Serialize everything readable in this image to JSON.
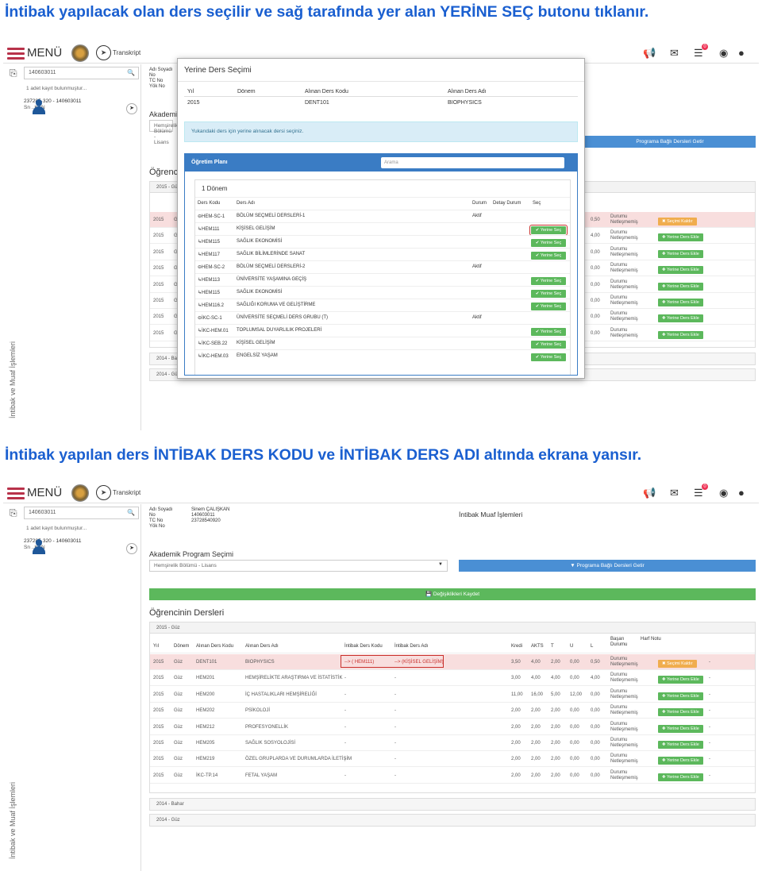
{
  "headings": {
    "top": "İntibak yapılacak olan ders seçilir ve sağ tarafında yer alan YERİNE SEÇ butonu tıklanır.",
    "bottom": "İntibak yapılan ders İNTİBAK DERS KODU ve İNTİBAK DERS ADI altında ekrana yansır."
  },
  "topbar": {
    "menu": "MENÜ",
    "transkript": "Transkript"
  },
  "sidebar": {
    "search_value": "140603011",
    "note": "1 adet kayıt bulunmuştur...",
    "student_line": "237285·320 - 140603011",
    "student_name_partial": "Sn ..KAN",
    "vertical_label": "İntibak ve Muaf İşlemleri"
  },
  "info": {
    "labels": [
      "Adı Soyadı",
      "No",
      "TC No",
      "Yök No"
    ],
    "values": [
      "Sinem ÇALIŞKAN",
      "140603011",
      "23728540920",
      ""
    ]
  },
  "page_title": "İntibak Muaf İşlemleri",
  "program": {
    "title": "Akademik Program Seçimi",
    "selected": "Hemşirelik Bölümü - Lisans",
    "btn": "Programa Bağlı Dersleri Getir"
  },
  "save_bar": "Değişiklikleri Kaydet",
  "courses": {
    "title": "Öğrencinin Dersleri",
    "term": "2015 - Güz",
    "headers": [
      "Yıl",
      "Dönem",
      "Alınan Ders Kodu",
      "Alınan Ders Adı",
      "İntibak Ders Kodu",
      "İntibak Ders Adı",
      "Kredi",
      "AKTS",
      "T",
      "U",
      "L",
      "Başarı Durumu",
      "Harf Notu"
    ],
    "rows": [
      [
        "2015",
        "Güz",
        "DENT101",
        "BIOPHYSICS",
        "--> ( HEM111)",
        "--> (KİŞİSEL GELİŞİM)",
        "3,50",
        "4,00",
        "2,00",
        "0,00",
        "0,50",
        "Durumu Netleşmemiş",
        "",
        ""
      ],
      [
        "2015",
        "Güz",
        "HEM201",
        "HEMŞİRELİKTE ARAŞTIRMA VE İSTATİSTİK",
        "-",
        "-",
        "3,00",
        "4,00",
        "4,00",
        "0,00",
        "4,00",
        "Durumu Netleşmemiş",
        "",
        ""
      ],
      [
        "2015",
        "Güz",
        "HEM200",
        "İÇ HASTALIKLARI HEMŞİRELİĞİ",
        "-",
        "-",
        "11,00",
        "16,00",
        "5,00",
        "12,00",
        "0,00",
        "Durumu Netleşmemiş",
        "",
        ""
      ],
      [
        "2015",
        "Güz",
        "HEM202",
        "PSİKOLOJİ",
        "-",
        "-",
        "2,00",
        "2,00",
        "2,00",
        "0,00",
        "0,00",
        "Durumu Netleşmemiş",
        "",
        ""
      ],
      [
        "2015",
        "Güz",
        "HEM212",
        "PROFESYONELLİK",
        "-",
        "-",
        "2,00",
        "2,00",
        "2,00",
        "0,00",
        "0,00",
        "Durumu Netleşmemiş",
        "",
        ""
      ],
      [
        "2015",
        "Güz",
        "HEM205",
        "SAĞLIK SOSYOLOJİSİ",
        "-",
        "-",
        "2,00",
        "2,00",
        "2,00",
        "0,00",
        "0,00",
        "Durumu Netleşmemiş",
        "",
        ""
      ],
      [
        "2015",
        "Güz",
        "HEM219",
        "ÖZEL GRUPLARDA VE DURUMLARDA İLETİŞİM",
        "-",
        "-",
        "2,00",
        "2,00",
        "2,00",
        "0,00",
        "0,00",
        "Durumu Netleşmemiş",
        "",
        ""
      ],
      [
        "2015",
        "Güz",
        "İKC-TP.14",
        "FETAL YAŞAM",
        "-",
        "-",
        "2,00",
        "2,00",
        "2,00",
        "0,00",
        "0,00",
        "Durumu Netleşmemiş",
        "",
        ""
      ]
    ],
    "btn_remove": "✖ Seçimi Kaldır",
    "btn_add": "✚ Yerine Ders Ekle",
    "other_terms": [
      "2014 - Bahar",
      "2014 - Güz"
    ]
  },
  "top_rows_partial": [
    [
      "2015",
      "Gü"
    ],
    [
      "2015",
      "Gü"
    ],
    [
      "2015",
      "Gü"
    ],
    [
      "2015",
      "Gü"
    ],
    [
      "2015",
      "Gü"
    ],
    [
      "2015",
      "Gü"
    ],
    [
      "2015",
      "Gü"
    ],
    [
      "2015",
      "Gü"
    ]
  ],
  "top_right_vals": [
    [
      "0,50",
      "Durumu Netleşmemiş"
    ],
    [
      "4,00",
      "Durumu Netleşmemiş"
    ],
    [
      "0,00",
      "Durumu Netleşmemiş"
    ],
    [
      "0,00",
      "Durumu Netleşmemiş"
    ],
    [
      "0,00",
      "Durumu Netleşmemiş"
    ],
    [
      "0,00",
      "Durumu Netleşmemiş"
    ],
    [
      "0,00",
      "Durumu Netleşmemiş"
    ],
    [
      "0,00",
      "Durumu Netleşmemiş"
    ]
  ],
  "modal": {
    "title": "Yerine Ders Seçimi",
    "headers": [
      "Yıl",
      "Dönem",
      "Alınan Ders Kodu",
      "Alınan Ders Adı"
    ],
    "values": [
      "2015",
      "",
      "DENT101",
      "BIOPHYSICS"
    ],
    "alert": "Yukarıdaki ders için yerine alınacak dersi seçiniz.",
    "plan_title": "Öğretim Planı",
    "plan_search": "Arama",
    "donem": "1 Dönem",
    "cols": [
      "Ders Kodu",
      "Ders Adı",
      "Durum",
      "Detay Durum",
      "Seç"
    ],
    "rows": [
      {
        "code": "⊖HEM-SC-1",
        "name": "BÖLÜM SEÇMELİ DERSLERİ-1",
        "status": "Aktif",
        "btn": ""
      },
      {
        "code": "↳HEM111",
        "name": "KİŞİSEL GELİŞİM",
        "status": "",
        "btn": "✔ Yerine Seç"
      },
      {
        "code": "↳HEM115",
        "name": "SAĞLIK EKONOMİSİ",
        "status": "",
        "btn": "✔ Yerine Seç"
      },
      {
        "code": "↳HEM117",
        "name": "SAĞLIK BİLİMLERİNDE SANAT",
        "status": "",
        "btn": "✔ Yerine Seç"
      },
      {
        "code": "⊖HEM-SC-2",
        "name": "BÖLÜM SEÇMELİ DERSLERİ-2",
        "status": "Aktif",
        "btn": ""
      },
      {
        "code": "↳HEM113",
        "name": "ÜNİVERSİTE YAŞAMINA GEÇİŞ",
        "status": "",
        "btn": "✔ Yerine Seç"
      },
      {
        "code": "↳HEM115",
        "name": "SAĞLIK EKONOMİSİ",
        "status": "",
        "btn": "✔ Yerine Seç"
      },
      {
        "code": "↳HEM116.2",
        "name": "SAĞLIĞI KORUMA VE GELİŞTİRME",
        "status": "",
        "btn": "✔ Yerine Seç"
      },
      {
        "code": "⊖İKC-SC-1",
        "name": "ÜNİVERSİTE SEÇMELİ DERS GRUBU (T)",
        "status": "Aktif",
        "btn": ""
      },
      {
        "code": "↳İKC-HEM.01",
        "name": "TOPLUMSAL DUYARLILIK PROJELERİ",
        "status": "",
        "btn": "✔ Yerine Seç"
      },
      {
        "code": "↳İKC-SEB.22",
        "name": "KİŞİSEL GELİŞİM",
        "status": "",
        "btn": "✔ Yerine Seç"
      },
      {
        "code": "↳İKC-HEM.03",
        "name": "ENGELSİZ YAŞAM",
        "status": "",
        "btn": "✔ Yerine Seç"
      }
    ]
  },
  "colors": {
    "heading": "#1a5fd0",
    "green": "#5cb85c",
    "blue": "#4a8fd4",
    "orange": "#f0ad4e",
    "red_highlight": "#c9302c",
    "row_highlight": "#f8dede"
  }
}
